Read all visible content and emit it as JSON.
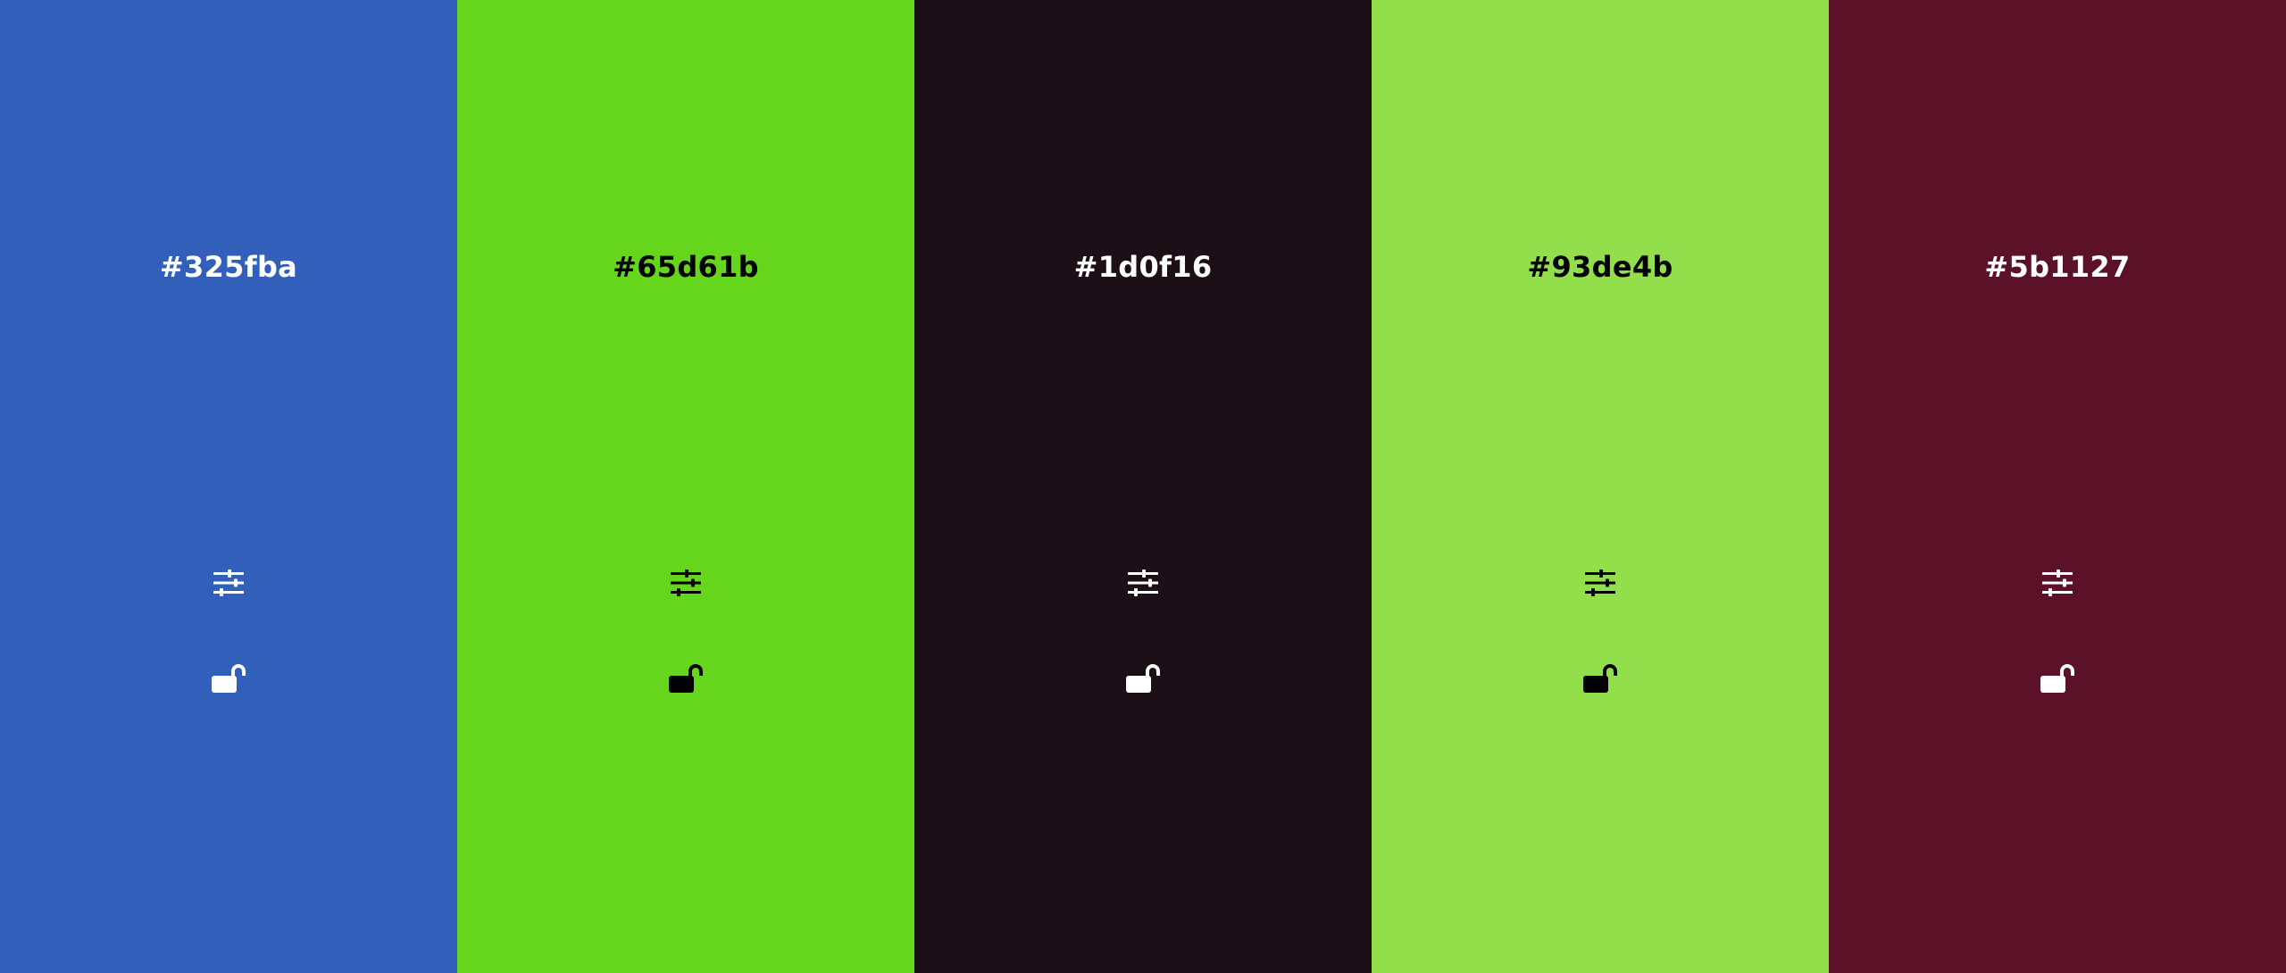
{
  "palette": {
    "colors": [
      {
        "hex": "#325fba",
        "background": "#325fba",
        "foreground": "#ffffff",
        "adjust_icon": "sliders-icon",
        "lock_icon": "unlocked-lock-icon"
      },
      {
        "hex": "#65d61b",
        "background": "#65d61b",
        "foreground": "#000000",
        "adjust_icon": "sliders-icon",
        "lock_icon": "unlocked-lock-icon"
      },
      {
        "hex": "#1d0f16",
        "background": "#1d0f16",
        "foreground": "#ffffff",
        "adjust_icon": "sliders-icon",
        "lock_icon": "unlocked-lock-icon"
      },
      {
        "hex": "#93de4b",
        "background": "#93de4b",
        "foreground": "#000000",
        "adjust_icon": "sliders-icon",
        "lock_icon": "unlocked-lock-icon"
      },
      {
        "hex": "#5b1127",
        "background": "#5b1127",
        "foreground": "#ffffff",
        "adjust_icon": "sliders-icon",
        "lock_icon": "unlocked-lock-icon"
      }
    ]
  }
}
